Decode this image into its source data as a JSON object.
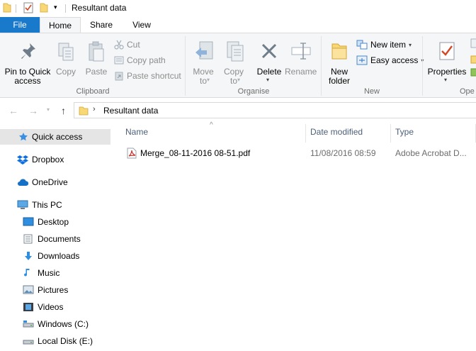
{
  "window": {
    "title": "Resultant data"
  },
  "tabs": [
    {
      "label": "File"
    },
    {
      "label": "Home"
    },
    {
      "label": "Share"
    },
    {
      "label": "View"
    }
  ],
  "ribbon": {
    "clipboard": {
      "group_label": "Clipboard",
      "pin_label_1": "Pin to Quick",
      "pin_label_2": "access",
      "copy_label": "Copy",
      "paste_label": "Paste",
      "cut_label": "Cut",
      "copy_path_label": "Copy path",
      "paste_shortcut_label": "Paste shortcut"
    },
    "organise": {
      "group_label": "Organise",
      "move_to_1": "Move",
      "move_to_2": "to",
      "copy_to_1": "Copy",
      "copy_to_2": "to",
      "delete_label": "Delete",
      "rename_label": "Rename"
    },
    "new": {
      "group_label": "New",
      "new_folder_1": "New",
      "new_folder_2": "folder",
      "new_item_label": "New item",
      "easy_access_label": "Easy access"
    },
    "open": {
      "group_label": "Ope",
      "properties_label": "Properties"
    }
  },
  "address": {
    "path": "Resultant data"
  },
  "navigation": {
    "items": [
      {
        "label": "Quick access",
        "icon": "star-icon"
      },
      {
        "label": "Dropbox",
        "icon": "dropbox-icon"
      },
      {
        "label": "OneDrive",
        "icon": "cloud-icon"
      },
      {
        "label": "This PC",
        "icon": "computer-icon"
      },
      {
        "label": "Desktop",
        "icon": "desktop-icon"
      },
      {
        "label": "Documents",
        "icon": "documents-icon"
      },
      {
        "label": "Downloads",
        "icon": "download-icon"
      },
      {
        "label": "Music",
        "icon": "music-icon"
      },
      {
        "label": "Pictures",
        "icon": "pictures-icon"
      },
      {
        "label": "Videos",
        "icon": "videos-icon"
      },
      {
        "label": "Windows (C:)",
        "icon": "drive-icon"
      },
      {
        "label": "Local Disk (E:)",
        "icon": "drive-icon"
      }
    ]
  },
  "filelist": {
    "columns": [
      {
        "label": "Name"
      },
      {
        "label": "Date modified"
      },
      {
        "label": "Type"
      }
    ],
    "rows": [
      {
        "name": "Merge_08-11-2016 08-51.pdf",
        "date": "11/08/2016 08:59",
        "type": "Adobe Acrobat D..."
      }
    ]
  },
  "colors": {
    "accent": "#1979ca",
    "ribbon_bg": "#f5f6f7",
    "selected_bg": "#e5e5e5",
    "folder_yellow": "#f8d775",
    "pdf_red": "#c4302b"
  }
}
